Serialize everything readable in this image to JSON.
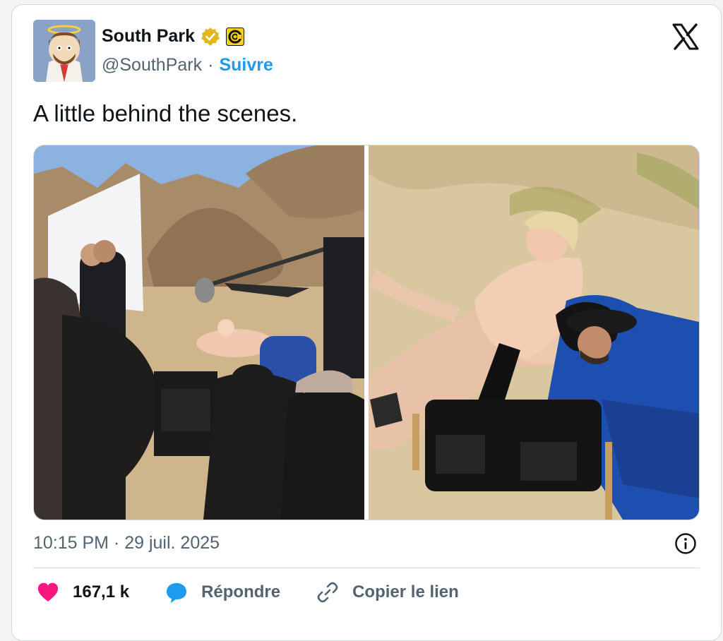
{
  "author": {
    "name": "South Park",
    "handle": "@SouthPark",
    "separator": "·",
    "follow_label": "Suivre",
    "verified_icon": "gold-verified-badge-icon",
    "affiliate_icon": "comedy-central-badge-icon"
  },
  "tweet": {
    "text": "A little behind the scenes.",
    "timestamp": "10:15 PM · 29 juil. 2025"
  },
  "media": {
    "photos": [
      {
        "icon": "film-set-desert-photo"
      },
      {
        "icon": "actor-lying-on-sand-photo"
      }
    ]
  },
  "actions": {
    "likes": "167,1 k",
    "reply_label": "Répondre",
    "copy_link_label": "Copier le lien"
  },
  "colors": {
    "accent": "#1d9bf0",
    "like": "#f91880",
    "text": "#0f1419",
    "muted": "#536471"
  }
}
